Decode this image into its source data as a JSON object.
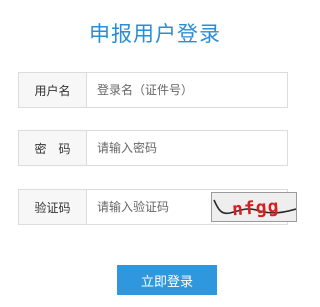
{
  "page": {
    "title": "申报用户登录"
  },
  "form": {
    "username": {
      "label": "用户名",
      "placeholder": "登录名（证件号）"
    },
    "password": {
      "label": "密　码",
      "placeholder": "请输入密码"
    },
    "captcha": {
      "label": "验证码",
      "placeholder": "请输入验证码",
      "image_text": "nfgg"
    },
    "submit_label": "立即登录"
  },
  "colors": {
    "title": "#2a8ed4",
    "button": "#2f97dd",
    "captcha_text": "#d42020"
  }
}
